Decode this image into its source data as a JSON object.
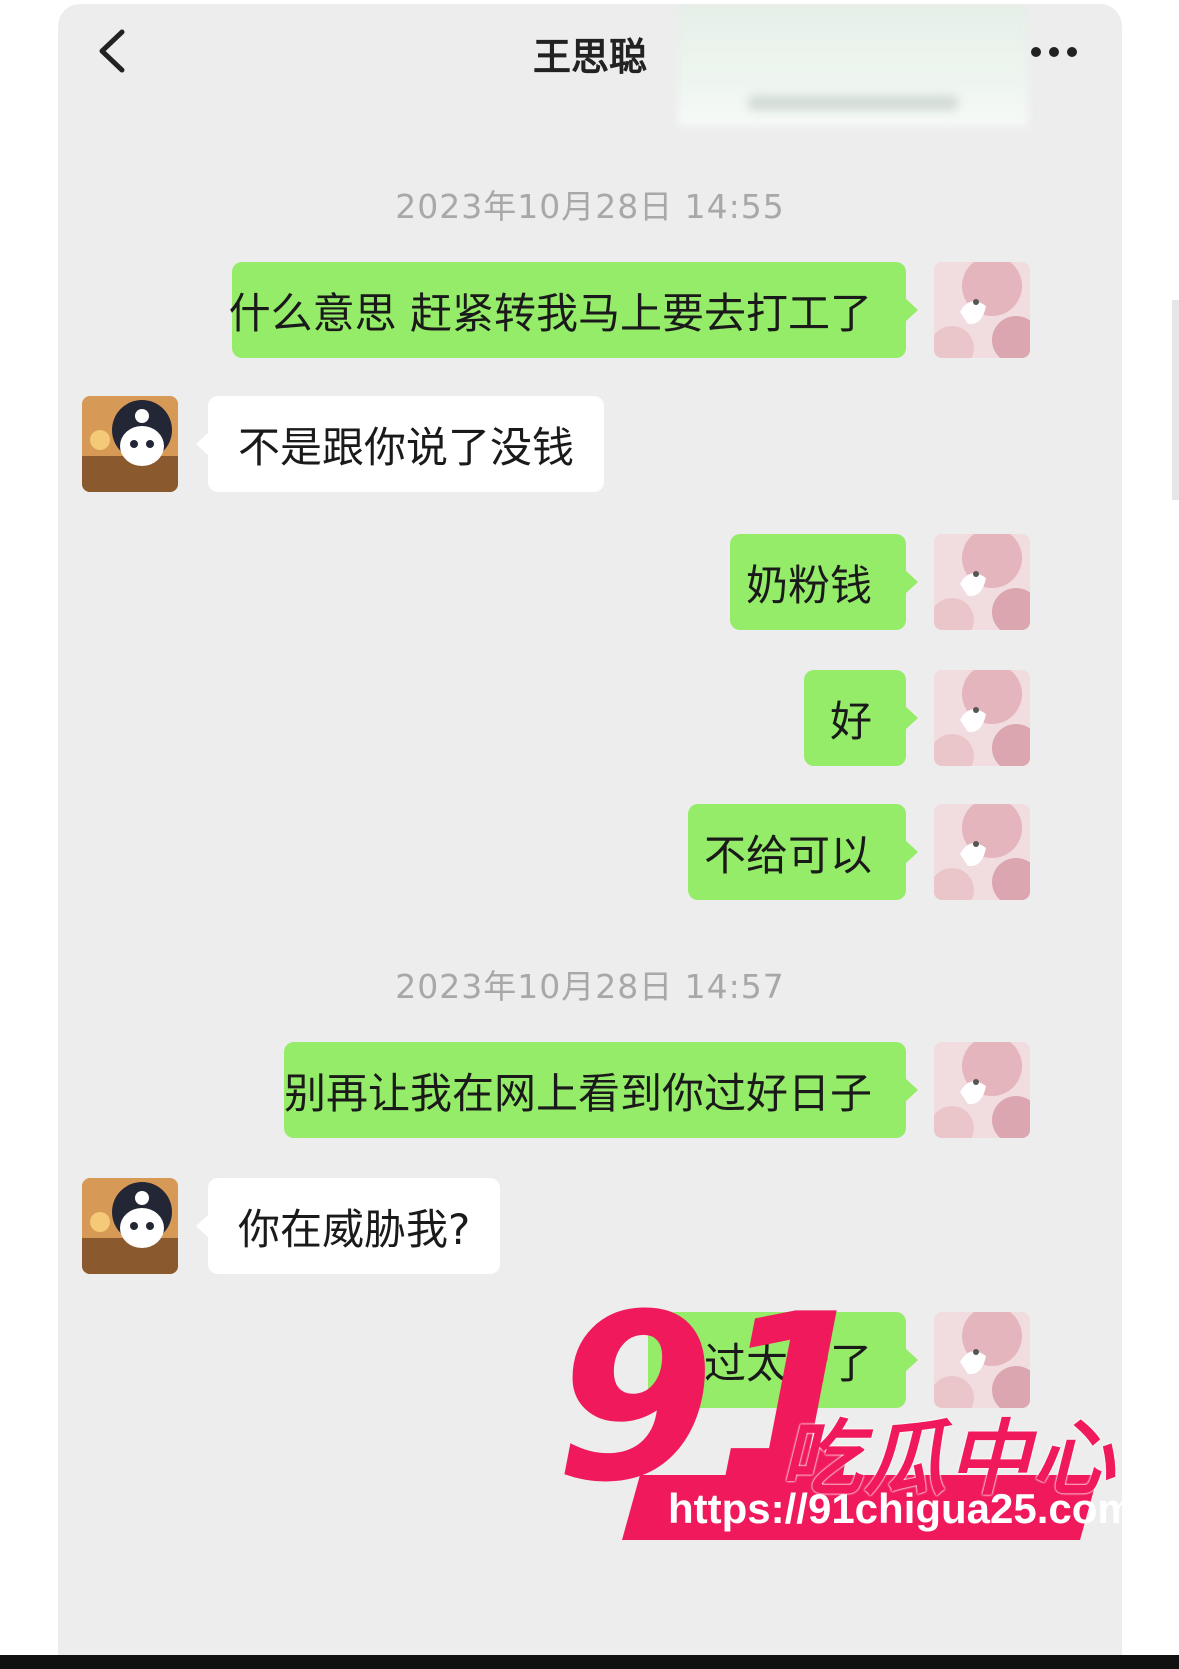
{
  "header": {
    "title": "王思聪",
    "back_icon": "chevron-left-icon",
    "more_icon": "more-dots-icon"
  },
  "messages": [
    {
      "type": "timestamp",
      "text": "2023年10月28日 14:55"
    },
    {
      "type": "bubble",
      "direction": "out",
      "text": "什么意思 赶紧转我马上要去打工了"
    },
    {
      "type": "bubble",
      "direction": "in",
      "text": "不是跟你说了没钱"
    },
    {
      "type": "bubble",
      "direction": "out",
      "text": "奶粉钱"
    },
    {
      "type": "bubble",
      "direction": "out",
      "text": "好"
    },
    {
      "type": "bubble",
      "direction": "out",
      "text": "不给可以"
    },
    {
      "type": "timestamp",
      "text": "2023年10月28日 14:57"
    },
    {
      "type": "bubble",
      "direction": "out",
      "text": "别再让我在网上看到你过好日子"
    },
    {
      "type": "bubble",
      "direction": "in",
      "text": "你在威胁我?"
    },
    {
      "type": "bubble",
      "direction": "out",
      "text": "过太苦了"
    }
  ],
  "watermark": {
    "logo_number": "91",
    "logo_text": "吃瓜中心",
    "url": "https://91chigua25.com"
  },
  "colors": {
    "background": "#ededed",
    "outgoing_bubble": "#95ec69",
    "incoming_bubble": "#ffffff",
    "timestamp_text": "#a8a8a8",
    "watermark": "#f0195c"
  }
}
